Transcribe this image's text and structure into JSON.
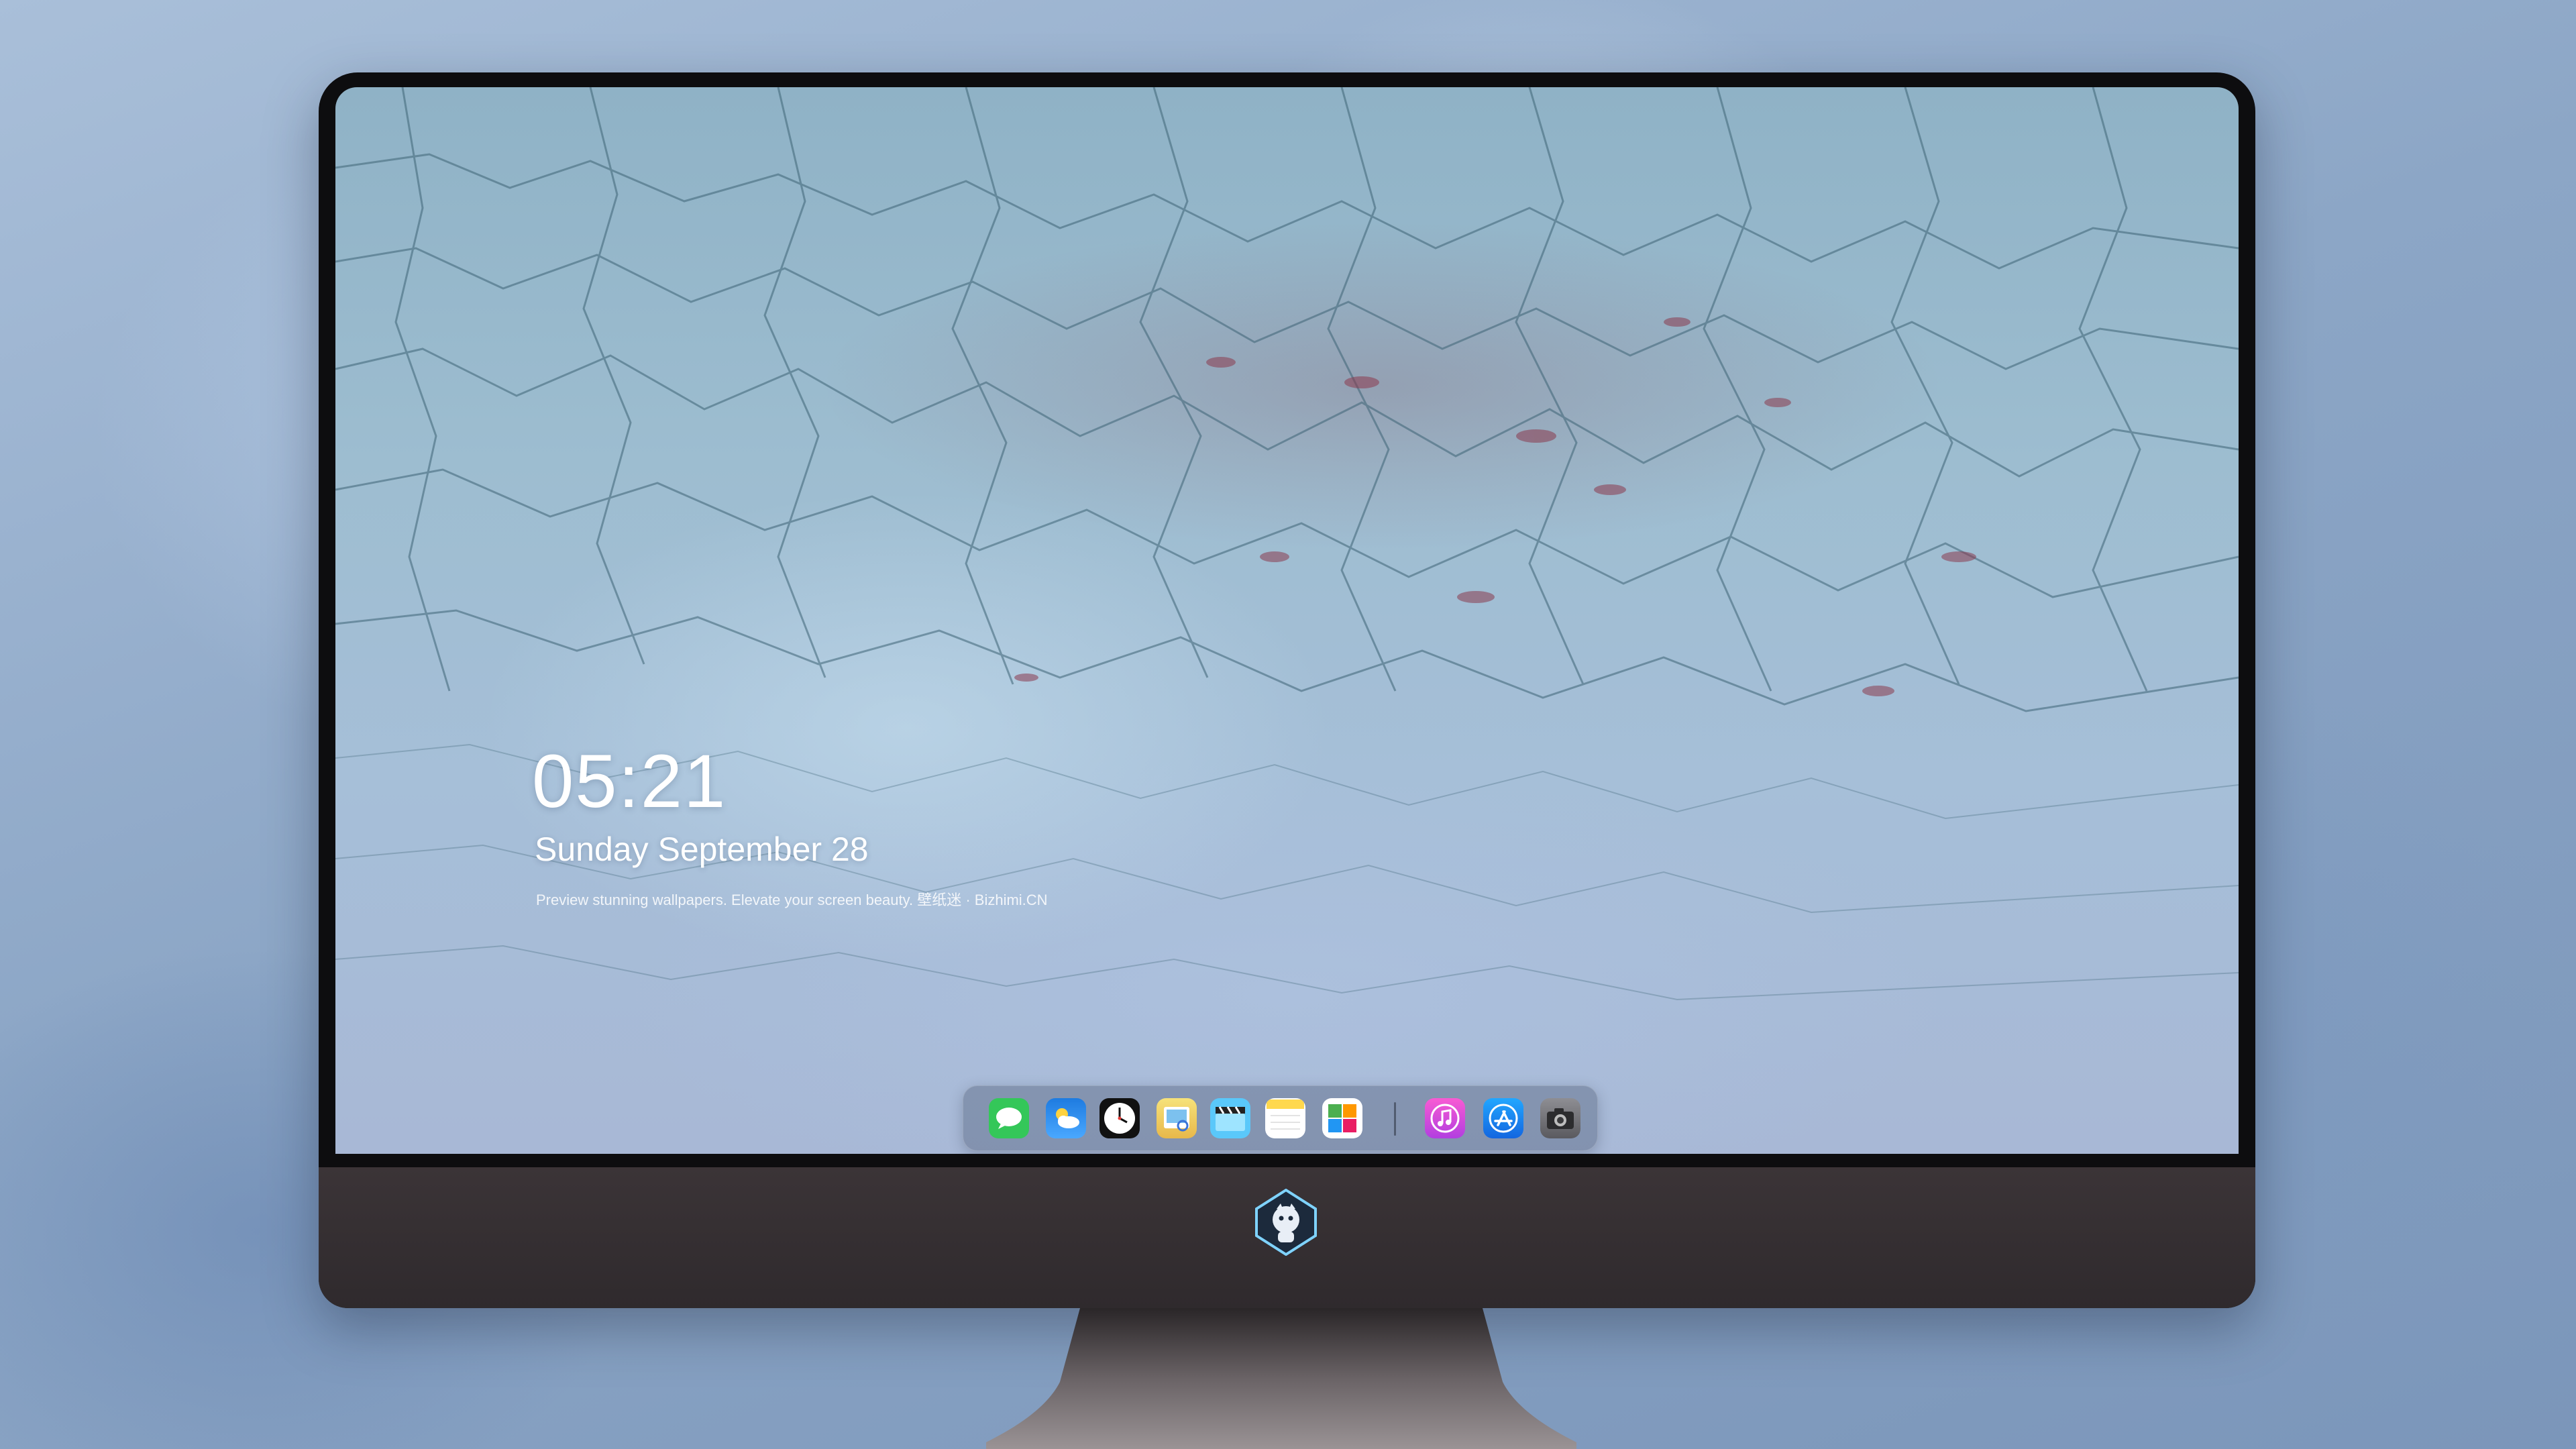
{
  "lockscreen": {
    "time": "05:21",
    "date": "Sunday September  28",
    "tagline": "Preview stunning wallpapers. Elevate your screen beauty. 壁纸迷 · Bizhimi.CN"
  },
  "dock": {
    "apps": [
      {
        "name": "messages-icon",
        "color": "#34c759"
      },
      {
        "name": "weather-icon",
        "color": "#2f8ff0"
      },
      {
        "name": "clock-icon",
        "color": "#111111"
      },
      {
        "name": "preview-icon",
        "color": "#f2c94c"
      },
      {
        "name": "video-clapper-icon",
        "color": "#5ac8fa"
      },
      {
        "name": "notes-icon",
        "color": "#ffd84d"
      },
      {
        "name": "photo-grid-icon",
        "color": "#8bc34a"
      },
      {
        "name": "music-icon",
        "color": "#e040c8"
      },
      {
        "name": "app-store-icon",
        "color": "#1f8fff"
      },
      {
        "name": "camera-icon",
        "color": "#6e6e73"
      }
    ]
  },
  "colors": {
    "monitor_bezel": "#0d0d0f",
    "monitor_chin": "#342e31",
    "wallpaper": "#9dbdd0"
  }
}
